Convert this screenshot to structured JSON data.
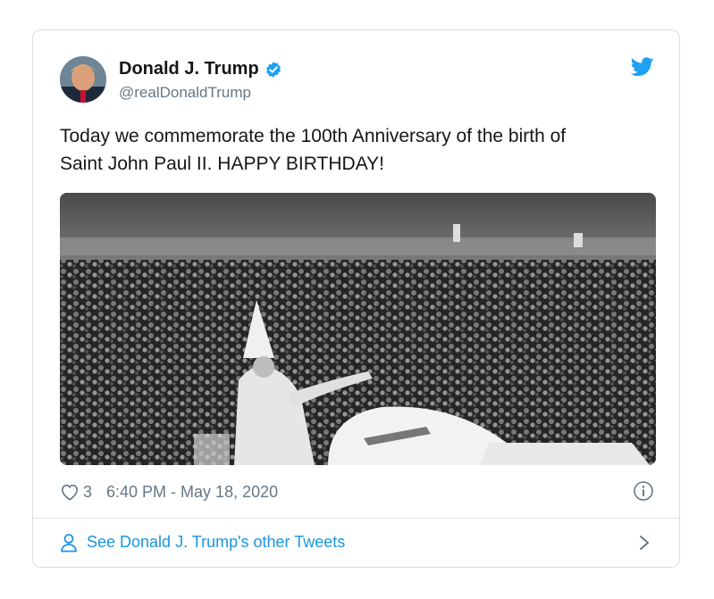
{
  "tweet": {
    "display_name": "Donald J. Trump",
    "handle": "@realDonaldTrump",
    "text_line1": "Today we commemorate the 100th Anniversary of the birth of",
    "text_line2": "Saint John Paul II. HAPPY BIRTHDAY!",
    "like_count": "3",
    "timestamp": "6:40 PM - May 18, 2020",
    "see_more_label": "See Donald J. Trump's other Tweets"
  },
  "icons": {
    "verified": "verified-badge-icon",
    "bird": "twitter-bird-icon",
    "heart": "heart-icon",
    "info": "info-icon",
    "person": "person-icon",
    "chevron": "chevron-right-icon"
  },
  "colors": {
    "brand": "#1da1f2",
    "link": "#1b95e0",
    "text": "#14171a",
    "secondary": "#657786",
    "border": "#d9dee2"
  }
}
